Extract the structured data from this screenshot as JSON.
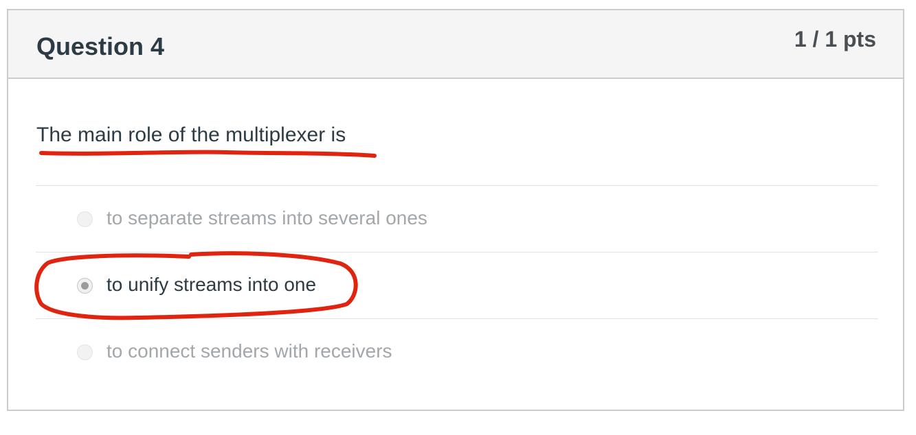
{
  "question": {
    "title": "Question 4",
    "points": "1 / 1 pts",
    "text": "The main role of the multiplexer is"
  },
  "answers": [
    {
      "label": "to separate streams into several ones",
      "selected": false
    },
    {
      "label": "to unify streams into one",
      "selected": true
    },
    {
      "label": "to connect senders with receivers",
      "selected": false
    }
  ],
  "colors": {
    "annotation": "#e0240f",
    "header_bg": "#f5f5f5",
    "text": "#2d3b45",
    "muted": "#a2a7ab"
  }
}
